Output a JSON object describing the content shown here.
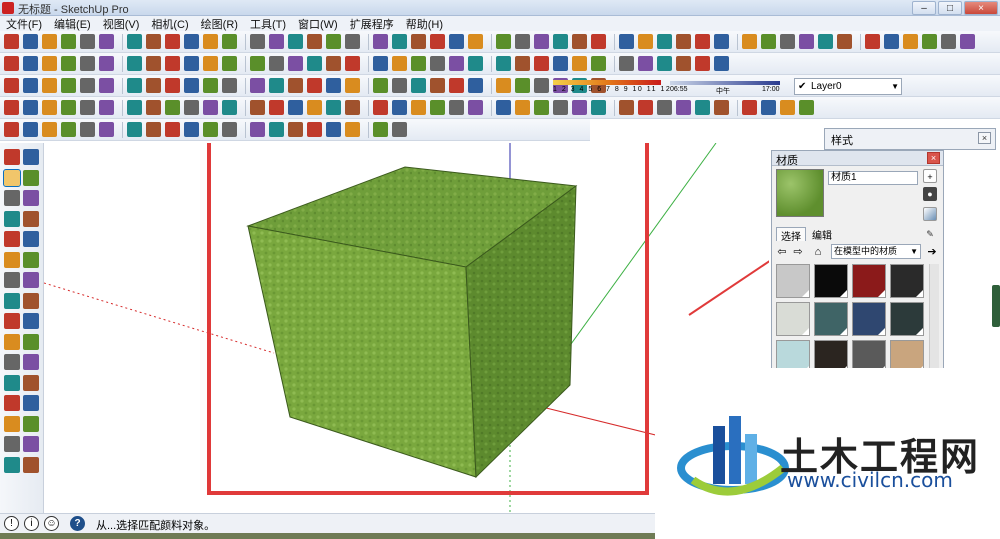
{
  "window": {
    "title": "无标题 - SketchUp Pro",
    "buttons": [
      "–",
      "□",
      "×"
    ]
  },
  "menu": [
    "文件(F)",
    "编辑(E)",
    "视图(V)",
    "相机(C)",
    "绘图(R)",
    "工具(T)",
    "窗口(W)",
    "扩展程序",
    "帮助(H)"
  ],
  "toolbar": {
    "layer_selected": "Layer0",
    "shadow_scale_numbers": "1 2 3 4 5 6 7 8 9 10 11 12",
    "time_start": "06:55",
    "time_mid": "中午",
    "time_end": "17:00",
    "row1_icons": [
      "select-icon",
      "eraser-icon",
      "pencil-icon",
      "arc-icon",
      "rectangle-icon",
      "push-pull-icon",
      "rotate-icon",
      "move-icon",
      "offset-icon",
      "tape-icon",
      "text-icon",
      "paint-bucket-icon",
      "orbit-icon",
      "pan-icon",
      "zoom-icon",
      "zoom-extents-icon"
    ],
    "row2_icons": [
      "iso-view-icon",
      "top-view-icon",
      "front-view-icon",
      "right-view-icon",
      "back-view-icon",
      "left-view-icon",
      "xray-icon",
      "wireframe-icon",
      "hidden-line-icon",
      "shaded-icon",
      "textured-icon",
      "monochrome-icon"
    ],
    "row3_icons": [
      "component-icon",
      "group-icon",
      "section-plane-icon",
      "section-cut-icon",
      "sandbox-icon",
      "smoove-icon",
      "stamp-icon",
      "drape-icon",
      "add-detail-icon",
      "flip-edge-icon"
    ],
    "row4_icons": [
      "follow-me-icon",
      "intersect-icon",
      "outer-shell-icon",
      "union-icon",
      "subtract-icon",
      "trim-icon",
      "split-icon",
      "solid-inspector-icon"
    ],
    "row5_icons": [
      "home-icon",
      "house-icon",
      "warehouse-icon",
      "walk-icon",
      "position-camera-icon",
      "look-around-icon",
      "axes-icon",
      "dimension-icon",
      "protractor-icon",
      "3d-text-icon"
    ]
  },
  "left_toolbar_icons": [
    "select-icon",
    "component-icon",
    "paint-bucket-icon",
    "eraser-icon",
    "line-icon",
    "freehand-icon",
    "rectangle-icon",
    "rotated-rectangle-icon",
    "circle-icon",
    "polygon-icon",
    "arc-icon",
    "pie-icon",
    "move-icon",
    "push-pull-icon",
    "rotate-icon",
    "follow-me-icon",
    "scale-icon",
    "offset-icon",
    "tape-icon",
    "dimension-icon",
    "protractor-icon",
    "text-icon",
    "axes-icon",
    "3d-text-icon",
    "orbit-icon",
    "pan-icon",
    "zoom-icon",
    "zoom-window-icon",
    "zoom-extents-icon",
    "position-camera-icon",
    "walk-icon",
    "look-around-icon"
  ],
  "status": {
    "message": "从...选择匹配颜料对象。"
  },
  "styles_panel": {
    "title": "样式"
  },
  "materials_panel": {
    "title": "材质",
    "material_name": "材质1",
    "tabs": [
      "选择",
      "编辑"
    ],
    "library": "在模型中的材质",
    "swatches": [
      "#c8c8c8",
      "#0a0a0a",
      "#8b1a1a",
      "#2a2a2a",
      "#d9dcd6",
      "#3f6466",
      "#2f4770",
      "#2c3a3a",
      "#b9d9dc",
      "#2b2520",
      "#5a5a5a",
      "#c9a57e"
    ]
  },
  "watermark": {
    "brand": "土木工程网",
    "url": "www.civilcn.com"
  },
  "colors": {
    "cube_top": "#6f9e3a",
    "cube_left": "#7aa83e",
    "cube_right": "#5d8a2e",
    "highlight_frame": "#e03a3a",
    "axis_green": "#3cb043",
    "axis_red": "#d62b2b",
    "axis_blue": "#2a2aa8"
  }
}
